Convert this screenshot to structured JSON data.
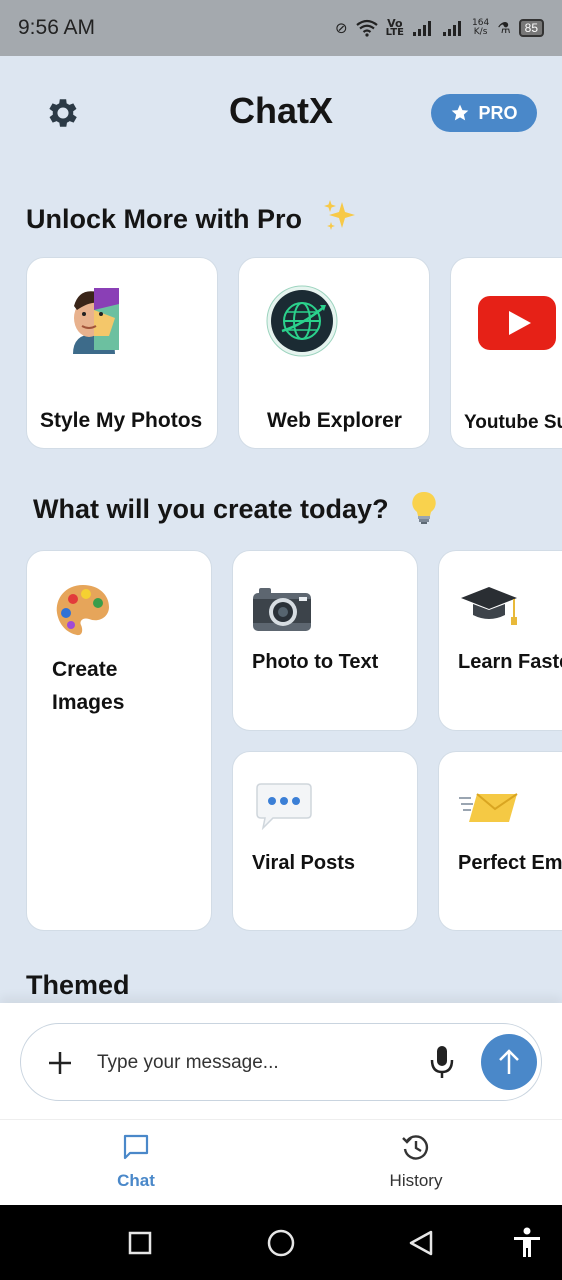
{
  "status_bar": {
    "time": "9:56 AM",
    "network_label_top": "Vo",
    "network_label_bottom": "LTE",
    "speed_top": "164",
    "speed_bottom": "K/s",
    "battery": "85"
  },
  "header": {
    "title": "ChatX",
    "pro_label": "PRO"
  },
  "pro_section": {
    "title": "Unlock More with Pro",
    "cards": [
      {
        "label": "Style My Photos",
        "icon": "portrait-art-icon"
      },
      {
        "label": "Web Explorer",
        "icon": "globe-icon"
      },
      {
        "label": "Youtube Su",
        "icon": "youtube-icon"
      }
    ]
  },
  "create_section": {
    "title": "What will you create today?",
    "cards": [
      {
        "label_line1": "Create",
        "label_line2": "Images",
        "icon": "palette-icon"
      },
      {
        "label": "Photo to Text",
        "icon": "camera-icon"
      },
      {
        "label": "Learn Faste",
        "icon": "graduation-cap-icon"
      },
      {
        "label": "Viral Posts",
        "icon": "speech-bubble-icon"
      },
      {
        "label": "Perfect Em",
        "icon": "envelope-icon"
      }
    ]
  },
  "themed_section": {
    "title": "Themed"
  },
  "input": {
    "placeholder": "Type your message..."
  },
  "bottom_nav": {
    "items": [
      {
        "label": "Chat",
        "active": true
      },
      {
        "label": "History",
        "active": false
      }
    ]
  },
  "colors": {
    "accent": "#4a88c9",
    "background": "#dde6f1",
    "status_bar": "#a4a9ae"
  }
}
